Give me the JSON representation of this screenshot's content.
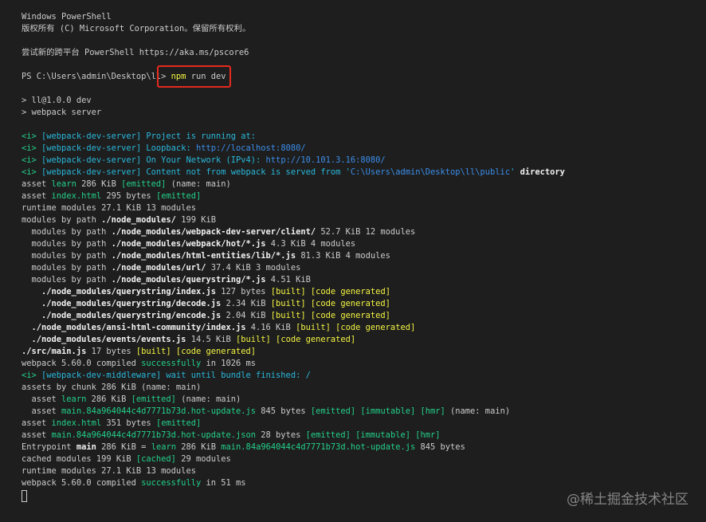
{
  "terminal": {
    "colors": {
      "background": "#1e1e1e",
      "default_text": "#cccccc",
      "green": "#23d18b",
      "cyan": "#29b8db",
      "yellow": "#f5f543",
      "blue": "#3b8eea",
      "highlight_box": "#e5291f"
    },
    "lines": [
      [
        [
          "d",
          "Windows PowerShell"
        ]
      ],
      [
        [
          "d",
          "版权所有 (C) Microsoft Corporation。保留所有权利。"
        ]
      ],
      [],
      [
        [
          "d",
          "尝试新的跨平台 PowerShell https://aka.ms/pscore6"
        ]
      ],
      [],
      [
        [
          "d",
          "PS C:\\Users\\admin\\Desktop\\ll> "
        ],
        [
          "y",
          "npm"
        ],
        [
          "d",
          " run dev"
        ]
      ],
      [],
      [
        [
          "d",
          "> ll@1.0.0 dev"
        ]
      ],
      [
        [
          "d",
          "> webpack server"
        ]
      ],
      [],
      [
        [
          "g",
          "<i> "
        ],
        [
          "c",
          "[webpack-dev-server] Project is running at:"
        ]
      ],
      [
        [
          "g",
          "<i> "
        ],
        [
          "c",
          "[webpack-dev-server] Loopback: "
        ],
        [
          "b",
          "http://localhost:8080/"
        ]
      ],
      [
        [
          "g",
          "<i> "
        ],
        [
          "c",
          "[webpack-dev-server] On Your Network (IPv4): "
        ],
        [
          "b",
          "http://10.101.3.16:8080/"
        ]
      ],
      [
        [
          "g",
          "<i> "
        ],
        [
          "c",
          "[webpack-dev-server] Content not from webpack is served from '"
        ],
        [
          "b",
          "C:\\Users\\admin\\Desktop\\ll\\public"
        ],
        [
          "c",
          "' "
        ],
        [
          "w",
          "directory"
        ]
      ],
      [
        [
          "d",
          "asset "
        ],
        [
          "g",
          "learn"
        ],
        [
          "d",
          " 286 KiB "
        ],
        [
          "g",
          "[emitted]"
        ],
        [
          "d",
          " (name: main)"
        ]
      ],
      [
        [
          "d",
          "asset "
        ],
        [
          "g",
          "index.html"
        ],
        [
          "d",
          " 295 bytes "
        ],
        [
          "g",
          "[emitted]"
        ]
      ],
      [
        [
          "d",
          "runtime modules 27.1 KiB 13 modules"
        ]
      ],
      [
        [
          "d",
          "modules by path "
        ],
        [
          "w",
          "./node_modules/"
        ],
        [
          "d",
          " 199 KiB"
        ]
      ],
      [
        [
          "d",
          "  modules by path "
        ],
        [
          "w",
          "./node_modules/webpack-dev-server/client/"
        ],
        [
          "d",
          " 52.7 KiB 12 modules"
        ]
      ],
      [
        [
          "d",
          "  modules by path "
        ],
        [
          "w",
          "./node_modules/webpack/hot/*.js"
        ],
        [
          "d",
          " 4.3 KiB 4 modules"
        ]
      ],
      [
        [
          "d",
          "  modules by path "
        ],
        [
          "w",
          "./node_modules/html-entities/lib/*.js"
        ],
        [
          "d",
          " 81.3 KiB 4 modules"
        ]
      ],
      [
        [
          "d",
          "  modules by path "
        ],
        [
          "w",
          "./node_modules/url/"
        ],
        [
          "d",
          " 37.4 KiB 3 modules"
        ]
      ],
      [
        [
          "d",
          "  modules by path "
        ],
        [
          "w",
          "./node_modules/querystring/*.js"
        ],
        [
          "d",
          " 4.51 KiB"
        ]
      ],
      [
        [
          "w",
          "    ./node_modules/querystring/index.js"
        ],
        [
          "d",
          " 127 bytes "
        ],
        [
          "y",
          "[built] [code generated]"
        ]
      ],
      [
        [
          "w",
          "    ./node_modules/querystring/decode.js"
        ],
        [
          "d",
          " 2.34 KiB "
        ],
        [
          "y",
          "[built] [code generated]"
        ]
      ],
      [
        [
          "w",
          "    ./node_modules/querystring/encode.js"
        ],
        [
          "d",
          " 2.04 KiB "
        ],
        [
          "y",
          "[built] [code generated]"
        ]
      ],
      [
        [
          "w",
          "  ./node_modules/ansi-html-community/index.js"
        ],
        [
          "d",
          " 4.16 KiB "
        ],
        [
          "y",
          "[built] [code generated]"
        ]
      ],
      [
        [
          "w",
          "  ./node_modules/events/events.js"
        ],
        [
          "d",
          " 14.5 KiB "
        ],
        [
          "y",
          "[built] [code generated]"
        ]
      ],
      [
        [
          "w",
          "./src/main.js"
        ],
        [
          "d",
          " 17 bytes "
        ],
        [
          "y",
          "[built] [code generated]"
        ]
      ],
      [
        [
          "d",
          "webpack 5.60.0 compiled "
        ],
        [
          "g",
          "successfully"
        ],
        [
          "d",
          " in 1026 ms"
        ]
      ],
      [
        [
          "g",
          "<i> "
        ],
        [
          "c",
          "[webpack-dev-middleware] wait until bundle finished: /"
        ]
      ],
      [
        [
          "d",
          "assets by chunk 286 KiB (name: main)"
        ]
      ],
      [
        [
          "d",
          "  asset "
        ],
        [
          "g",
          "learn"
        ],
        [
          "d",
          " 286 KiB "
        ],
        [
          "g",
          "[emitted]"
        ],
        [
          "d",
          " (name: main)"
        ]
      ],
      [
        [
          "d",
          "  asset "
        ],
        [
          "g",
          "main.84a964044c4d7771b73d.hot-update.js"
        ],
        [
          "d",
          " 845 bytes "
        ],
        [
          "g",
          "[emitted] [immutable] [hmr]"
        ],
        [
          "d",
          " (name: main)"
        ]
      ],
      [
        [
          "d",
          "asset "
        ],
        [
          "g",
          "index.html"
        ],
        [
          "d",
          " 351 bytes "
        ],
        [
          "g",
          "[emitted]"
        ]
      ],
      [
        [
          "d",
          "asset "
        ],
        [
          "g",
          "main.84a964044c4d7771b73d.hot-update.json"
        ],
        [
          "d",
          " 28 bytes "
        ],
        [
          "g",
          "[emitted] [immutable] [hmr]"
        ]
      ],
      [
        [
          "d",
          "Entrypoint "
        ],
        [
          "w",
          "main"
        ],
        [
          "d",
          " 286 KiB = "
        ],
        [
          "g",
          "learn"
        ],
        [
          "d",
          " 286 KiB "
        ],
        [
          "g",
          "main.84a964044c4d7771b73d.hot-update.js"
        ],
        [
          "d",
          " 845 bytes"
        ]
      ],
      [
        [
          "d",
          "cached modules 199 KiB "
        ],
        [
          "g",
          "[cached]"
        ],
        [
          "d",
          " 29 modules"
        ]
      ],
      [
        [
          "d",
          "runtime modules 27.1 KiB 13 modules"
        ]
      ],
      [
        [
          "d",
          "webpack 5.60.0 compiled "
        ],
        [
          "g",
          "successfully"
        ],
        [
          "d",
          " in 51 ms"
        ]
      ]
    ]
  },
  "watermark": "@稀土掘金技术社区"
}
